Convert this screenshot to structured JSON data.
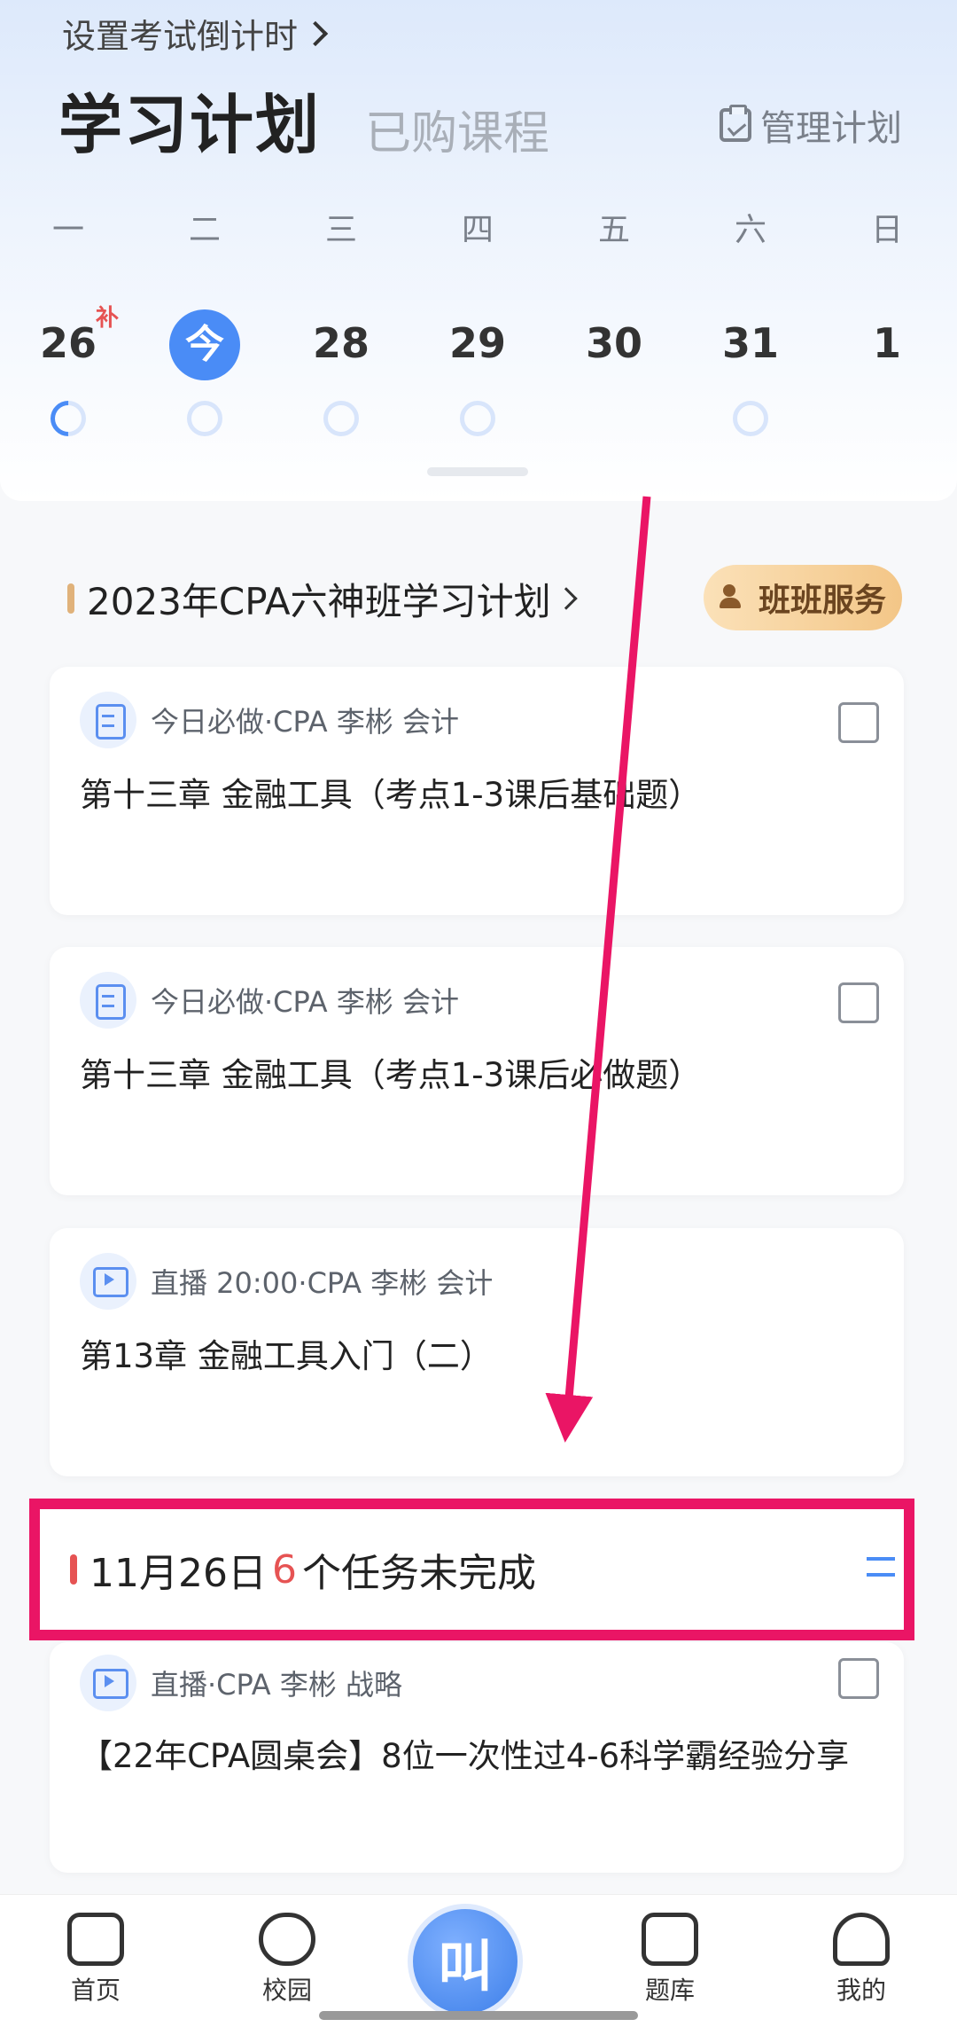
{
  "header": {
    "countdown_link": "设置考试倒计时",
    "tab_active": "学习计划",
    "tab_inactive": "已购课程",
    "manage_plan": "管理计划"
  },
  "week": {
    "weekdays": [
      "一",
      "二",
      "三",
      "四",
      "五",
      "六",
      "日"
    ],
    "dates": [
      "26",
      "今",
      "28",
      "29",
      "30",
      "31",
      "1"
    ],
    "makeup_badge": "补"
  },
  "plan": {
    "title": "2023年CPA六神班学习计划",
    "service_button": "班班服务"
  },
  "tasks": [
    {
      "meta": "今日必做·CPA 李彬 会计",
      "title": "第十三章 金融工具（考点1-3课后基础题）",
      "icon": "document-icon"
    },
    {
      "meta": "今日必做·CPA 李彬 会计",
      "title": "第十三章 金融工具（考点1-3课后必做题）",
      "icon": "document-icon"
    },
    {
      "meta": "直播 20:00·CPA 李彬 会计",
      "title": "第13章 金融工具入门（二）",
      "icon": "video-icon"
    }
  ],
  "pending": {
    "date": "11月26日",
    "count": "6",
    "suffix": "个任务未完成"
  },
  "pending_task": {
    "meta": "直播·CPA 李彬 战略",
    "title": "【22年CPA圆桌会】8位一次性过4-6科学霸经验分享",
    "icon": "video-icon"
  },
  "nav": {
    "home": "首页",
    "campus": "校园",
    "center": "叫",
    "question_bank": "题库",
    "mine": "我的"
  },
  "colors": {
    "accent": "#4a8cf6",
    "highlight": "#ea1565",
    "warning": "#e65353"
  }
}
